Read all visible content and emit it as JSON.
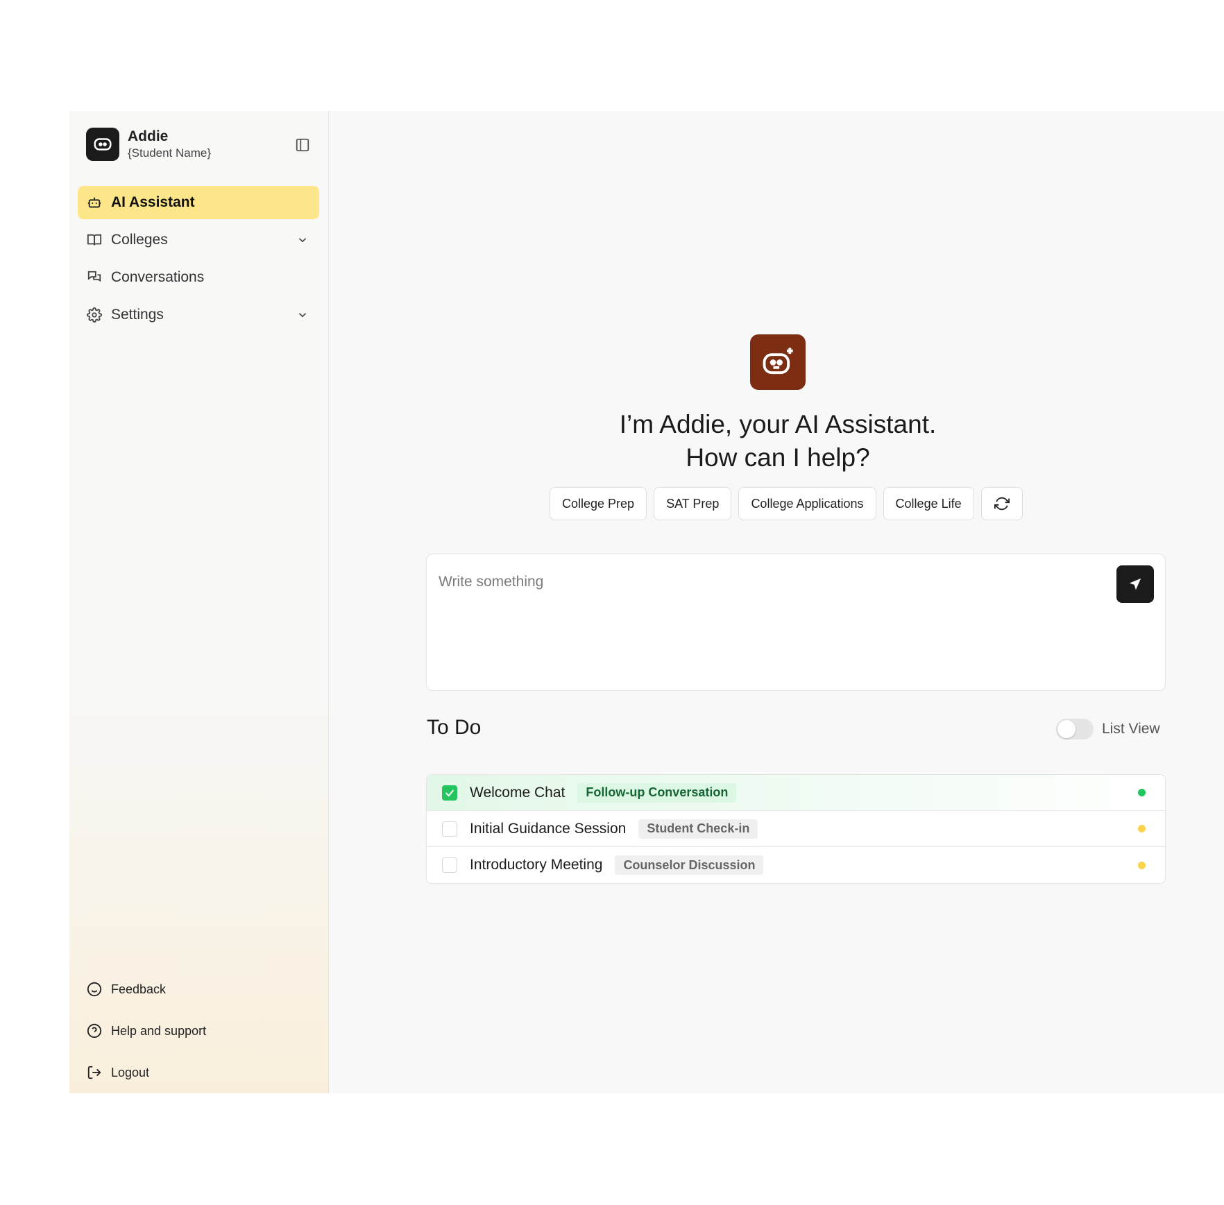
{
  "brand": {
    "name": "Addie",
    "subtitle": "{Student Name}",
    "logo_icon": "robot-face-icon"
  },
  "sidebar": {
    "collapse_icon": "sidebar-panel-icon",
    "items": [
      {
        "label": "AI Assistant",
        "icon": "robot-icon",
        "active": true,
        "has_chevron": false
      },
      {
        "label": "Colleges",
        "icon": "book-open-icon",
        "active": false,
        "has_chevron": true
      },
      {
        "label": "Conversations",
        "icon": "chat-bubbles-icon",
        "active": false,
        "has_chevron": false
      },
      {
        "label": "Settings",
        "icon": "gear-icon",
        "active": false,
        "has_chevron": true
      }
    ],
    "bottom_items": [
      {
        "label": "Feedback",
        "icon": "smiley-icon"
      },
      {
        "label": "Help and support",
        "icon": "help-circle-icon"
      },
      {
        "label": "Logout",
        "icon": "logout-icon"
      }
    ]
  },
  "hero": {
    "line1": "I’m Addie, your AI Assistant.",
    "line2": "How can I help?"
  },
  "chips": [
    "College Prep",
    "SAT Prep",
    "College Applications",
    "College Life"
  ],
  "composer": {
    "placeholder": "Write something"
  },
  "todo": {
    "title": "To Do",
    "toggle_label": "List View",
    "toggle_on": false,
    "items": [
      {
        "text": "Welcome Chat",
        "tag": "Follow-up Conversation",
        "checked": true,
        "status_color": "#22c55e"
      },
      {
        "text": "Initial Guidance Session",
        "tag": "Student Check-in",
        "checked": false,
        "status_color": "#fcd34d"
      },
      {
        "text": "Introductory Meeting",
        "tag": "Counselor Discussion",
        "checked": false,
        "status_color": "#fcd34d"
      }
    ]
  },
  "colors": {
    "accent_active": "#fde68a",
    "hero_logo": "#7c2d12",
    "success": "#22c55e",
    "pending": "#fcd34d"
  }
}
